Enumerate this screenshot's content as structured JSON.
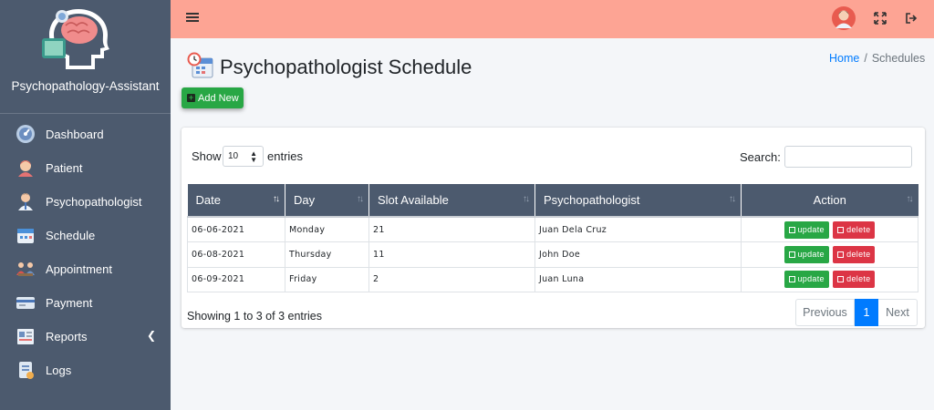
{
  "brand": {
    "name": "Psychopathology-Assistant"
  },
  "sidebar": {
    "items": [
      {
        "label": "Dashboard",
        "icon": "dashboard-icon"
      },
      {
        "label": "Patient",
        "icon": "patient-icon"
      },
      {
        "label": "Psychopathologist",
        "icon": "psychopathologist-icon"
      },
      {
        "label": "Schedule",
        "icon": "calendar-icon"
      },
      {
        "label": "Appointment",
        "icon": "appointment-icon"
      },
      {
        "label": "Payment",
        "icon": "payment-card-icon"
      },
      {
        "label": "Reports",
        "icon": "reports-icon"
      },
      {
        "label": "Logs",
        "icon": "logs-icon"
      }
    ]
  },
  "header": {
    "title": "Psychopathologist Schedule"
  },
  "breadcrumb": {
    "home": "Home",
    "separator": "/",
    "current": "Schedules"
  },
  "toolbar": {
    "add_new": "Add New"
  },
  "table_controls": {
    "show_label": "Show",
    "entries_value": "10",
    "entries_label": "entries",
    "search_label": "Search:"
  },
  "table": {
    "columns": [
      "Date",
      "Day",
      "Slot Available",
      "Psychopathologist",
      "Action"
    ],
    "rows": [
      {
        "date": "06-06-2021",
        "day": "Monday",
        "slot": "21",
        "psychopathologist": "Juan Dela Cruz"
      },
      {
        "date": "06-08-2021",
        "day": "Thursday",
        "slot": "11",
        "psychopathologist": "John Doe"
      },
      {
        "date": "06-09-2021",
        "day": "Friday",
        "slot": "2",
        "psychopathologist": "Juan Luna"
      }
    ],
    "update_label": "update",
    "delete_label": "delete"
  },
  "footer": {
    "info": "Showing 1 to 3 of 3 entries",
    "previous": "Previous",
    "page": "1",
    "next": "Next"
  },
  "colors": {
    "sidebar": "#4c5a6e",
    "topbar": "#fda494",
    "primary": "#007bff",
    "success": "#28a745",
    "danger": "#dc3545"
  }
}
